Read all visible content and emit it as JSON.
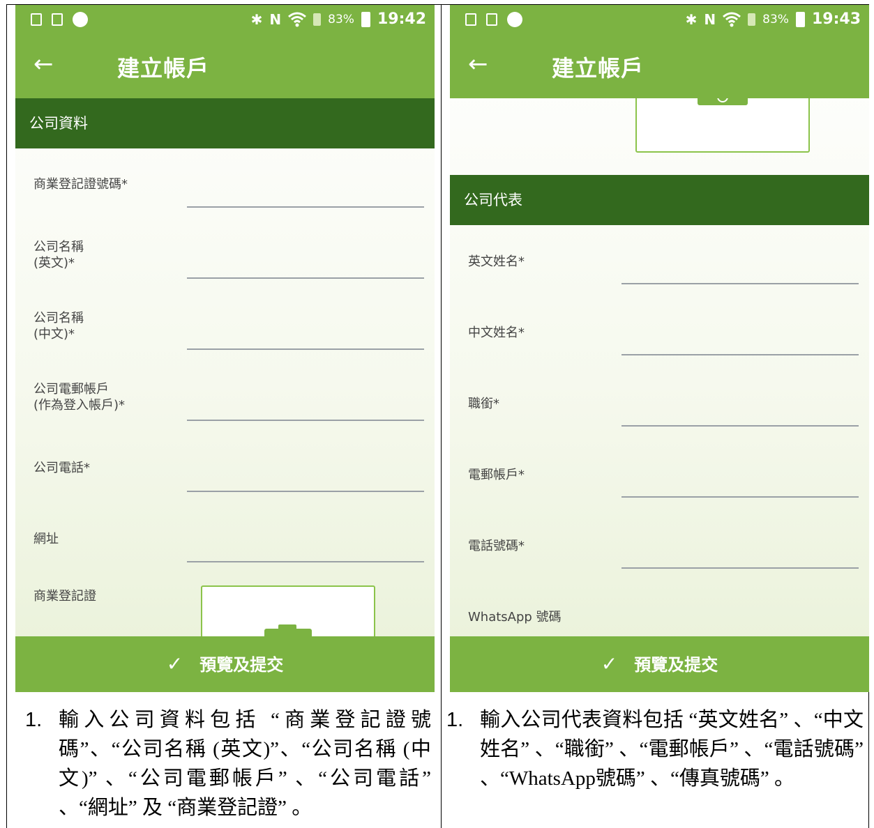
{
  "left_screen": {
    "status": {
      "battery_pct": "83%",
      "time": "19:42"
    },
    "app_title": "建立帳戶",
    "section_title": "公司資料",
    "fields": [
      {
        "label": "商業登記證號碼*"
      },
      {
        "label": "公司名稱\n(英文)*"
      },
      {
        "label": "公司名稱\n(中文)*"
      },
      {
        "label": "公司電郵帳戶\n(作為登入帳戶)*"
      },
      {
        "label": "公司電話*"
      },
      {
        "label": "網址"
      },
      {
        "label": "商業登記證"
      }
    ],
    "submit_label": "預覽及提交"
  },
  "right_screen": {
    "status": {
      "battery_pct": "83%",
      "time": "19:43"
    },
    "app_title": "建立帳戶",
    "section_title": "公司代表",
    "fields": [
      {
        "label": "英文姓名*"
      },
      {
        "label": "中文姓名*"
      },
      {
        "label": "職銜*"
      },
      {
        "label": "電郵帳戶*"
      },
      {
        "label": "電話號碼*"
      },
      {
        "label": "WhatsApp 號碼"
      }
    ],
    "submit_label": "預覽及提交"
  },
  "captions": {
    "left": {
      "number": "1.",
      "text": "輸入公司資料包括 “商業登記證號碼”、“公司名稱 (英文)”、“公司名稱 (中文)” 、“公司電郵帳戶” 、“公司電話” 、“網址” 及 “商業登記證” 。"
    },
    "right": {
      "number": "1.",
      "text": "輸入公司代表資料包括 “英文姓名” 、“中文姓名” 、“職銜” 、“電郵帳戶” 、“電話號碼” 、“WhatsApp號碼” 、“傳真號碼” 。"
    }
  },
  "colors": {
    "primary": "#7cb342",
    "primary_dark": "#33691e",
    "upload_border": "#8bc34a"
  },
  "icons": [
    "back-arrow-icon",
    "check-icon",
    "camera-icon",
    "bluetooth-icon",
    "nfc-icon",
    "wifi-icon",
    "battery-icon"
  ]
}
